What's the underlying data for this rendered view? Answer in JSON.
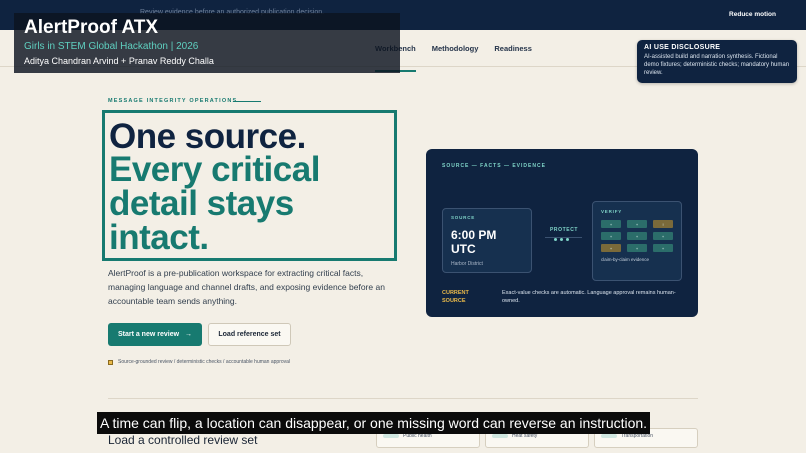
{
  "topbar": {
    "hidden_text": "Review evidence before an authorized publication decision.",
    "reduce_motion": "Reduce motion"
  },
  "nav": {
    "tabs": [
      {
        "label": "Workbench",
        "active": true
      },
      {
        "label": "Methodology",
        "active": false
      },
      {
        "label": "Readiness",
        "active": false
      }
    ]
  },
  "overlay": {
    "title": "AlertProof ATX",
    "event": "Girls in STEM Global Hackathon | 2026",
    "authors": "Aditya Chandran Arvind + Pranav Reddy Challa"
  },
  "disclosure": {
    "title": "AI USE DISCLOSURE",
    "body": "AI-assisted build and narration synthesis. Fictional demo fixtures; deterministic checks; mandatory human review."
  },
  "hero": {
    "eyebrow": "MESSAGE INTEGRITY OPERATIONS",
    "headline_line1": "One source.",
    "headline_line2": "Every critical detail stays intact.",
    "lede": "AlertProof is a pre-publication workspace for extracting critical facts, managing language and channel drafts, and exposing evidence before an accountable team sends anything.",
    "primary_button": "Start a new review",
    "primary_arrow": "→",
    "secondary_button": "Load reference set",
    "footnote": "Source-grounded review / deterministic checks / accountable human approval"
  },
  "card": {
    "eyebrow": "SOURCE — FACTS — EVIDENCE",
    "source_label": "SOURCE",
    "source_time": "6:00 PM UTC",
    "source_location": "Harbor District",
    "protect_label": "PROTECT",
    "verify_label": "VERIFY",
    "verify_cells": [
      "+",
      "+",
      "!",
      "+",
      "+",
      "+",
      "+",
      "+",
      "+"
    ],
    "verify_caption": "claim-by-claim evidence",
    "current_source": "CURRENT SOURCE",
    "current_note": "Exact-value checks are automatic. Language approval remains human-owned."
  },
  "subtitle": "A time can flip, a location can disappear, or one missing word can reverse an instruction.",
  "section": {
    "title": "Load a controlled review set",
    "chips": [
      "Public health",
      "Heat safety",
      "Transportation"
    ]
  },
  "colors": {
    "navy": "#0f2340",
    "teal": "#177a70",
    "gold": "#e9b949",
    "paper": "#f3efe6"
  }
}
